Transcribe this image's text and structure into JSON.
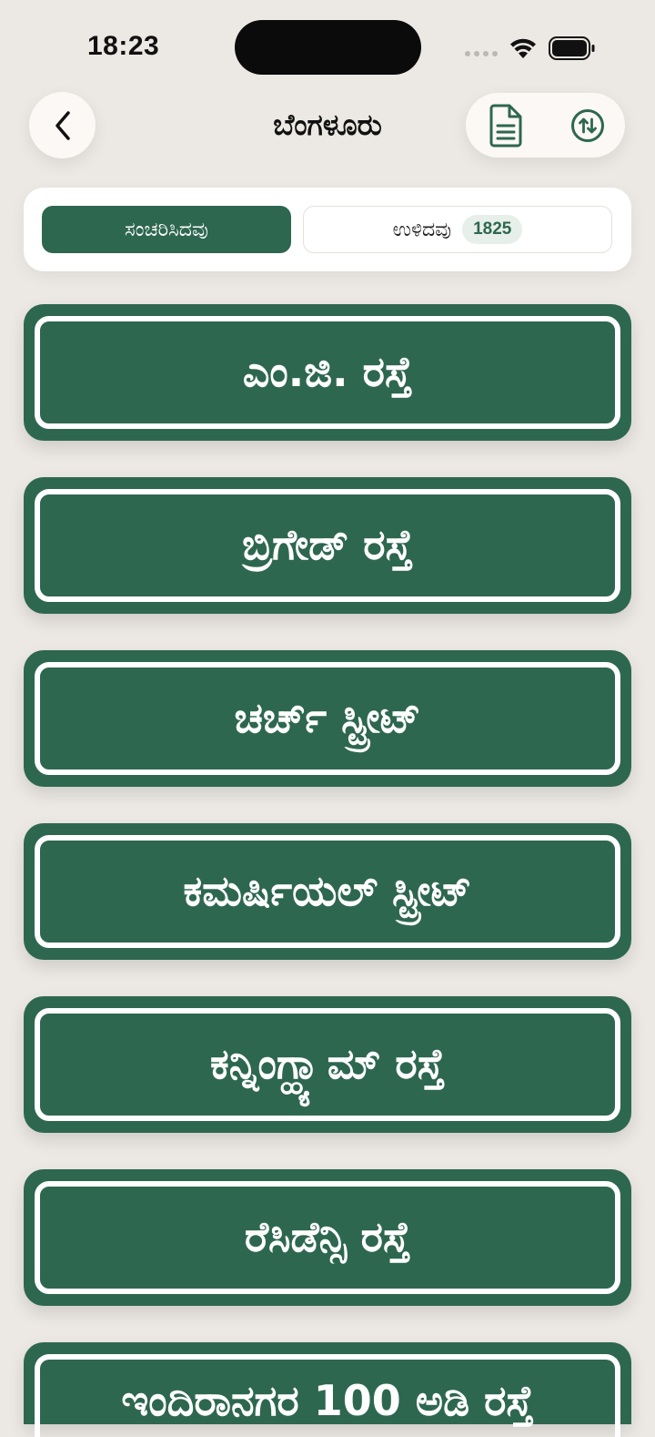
{
  "status_bar": {
    "time": "18:23"
  },
  "header": {
    "title": "ಬೆಂಗಳೂರು"
  },
  "segments": {
    "visited_label": "ಸಂಚರಿಸಿದವು",
    "remaining_label": "ಉಳಿದವು",
    "remaining_count": "1825"
  },
  "streets": [
    {
      "name": "ಎಂ.ಜಿ. ರಸ್ತೆ"
    },
    {
      "name": "ಬ್ರಿಗೇಡ್ ರಸ್ತೆ"
    },
    {
      "name": "ಚರ್ಚ್ ಸ್ಟ್ರೀಟ್"
    },
    {
      "name": "ಕಮರ್ಷಿಯಲ್ ಸ್ಟ್ರೀಟ್"
    },
    {
      "name": "ಕನ್ನಿಂಗ್ಹ್ಯಾಮ್ ರಸ್ತೆ"
    },
    {
      "name": "ರೆಸಿಡೆನ್ಸಿ ರಸ್ತೆ"
    },
    {
      "name": "ಇಂದಿರಾನಗರ 100 ಅಡಿ ರಸ್ತೆ"
    }
  ],
  "colors": {
    "background": "#ECE8E4",
    "accent": "#2E6750",
    "surface": "#FBF8F5"
  },
  "icons": {
    "back": "chevron-left-icon",
    "document": "document-icon",
    "sort": "sort-arrows-icon"
  }
}
